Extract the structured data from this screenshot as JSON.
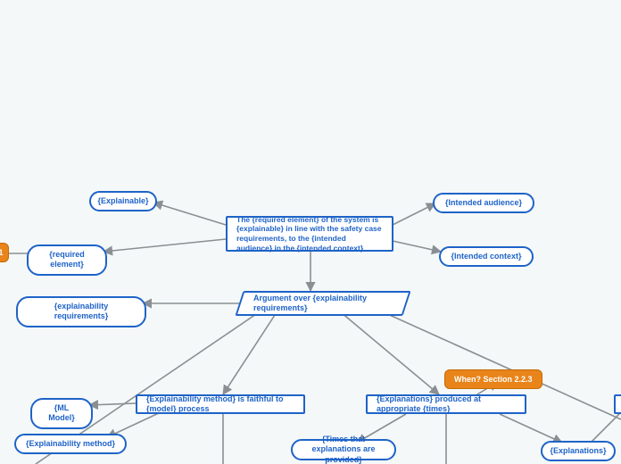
{
  "nodes": {
    "explainable": "{Explainable}",
    "required_element": "{required element}",
    "intended_audience": "{Intended audience}",
    "intended_context": "{Intended context}",
    "top_claim": "The {required element} of the system is {explainable} in line with the safety case requirements, to the {intended audience} in the {intended context}",
    "arg_over": "Argument over {explainability requirements}",
    "explainability_requirements": "{explainability requirements}",
    "ml_model": "{ML Model}",
    "explainability_method_pill": "{Explainability method}",
    "faithful": "{Explainability method} is faithful to {model} process",
    "produced_times": "{Explanations} produced at appropriate {times}",
    "times_provided": "{Times that explanations are provided}",
    "explanations": "{Explanations}",
    "when_section": "When? Section 2.2.3",
    "orange_left": "1"
  }
}
